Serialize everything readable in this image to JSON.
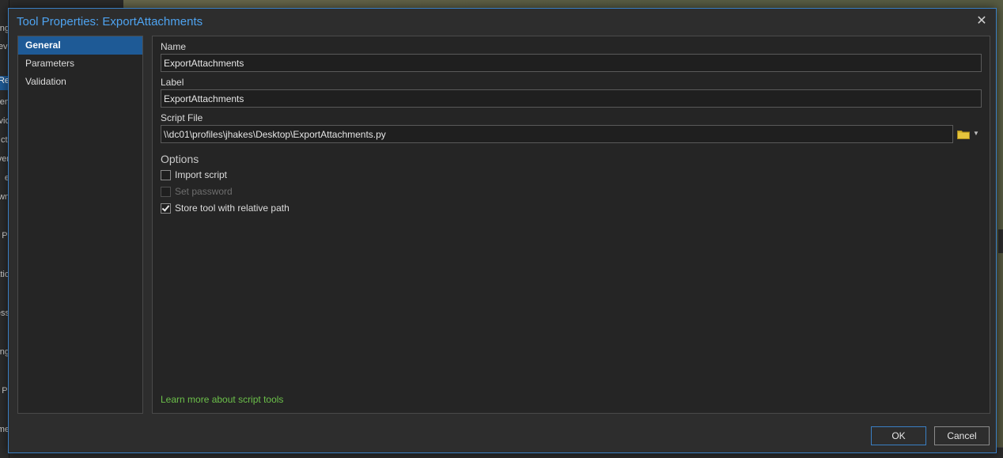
{
  "dialog": {
    "title": "Tool Properties: ExportAttachments",
    "close_glyph": "✕"
  },
  "nav": {
    "items": [
      {
        "label": "General",
        "active": true
      },
      {
        "label": "Parameters",
        "active": false
      },
      {
        "label": "Validation",
        "active": false
      }
    ]
  },
  "general": {
    "name_label": "Name",
    "name_value": "ExportAttachments",
    "label_label": "Label",
    "label_value": "ExportAttachments",
    "script_file_label": "Script File",
    "script_file_value": "\\\\dc01\\profiles\\jhakes\\Desktop\\ExportAttachments.py",
    "options_label": "Options",
    "options": [
      {
        "label": "Import script",
        "checked": false,
        "disabled": false
      },
      {
        "label": "Set password",
        "checked": false,
        "disabled": true
      },
      {
        "label": "Store tool with relative path",
        "checked": true,
        "disabled": false
      }
    ],
    "learn_more": "Learn more about script tools"
  },
  "footer": {
    "ok_label": "OK",
    "cancel_label": "Cancel"
  },
  "icons": {
    "folder": "folder-icon",
    "dropdown": "chevron-down-icon"
  },
  "colors": {
    "accent": "#1e5a96",
    "title_blue": "#4ea3f0",
    "link_green": "#6cc04a",
    "folder_yellow": "#d8b62e"
  },
  "background": {
    "left_fragments": [
      "ng",
      "evi",
      "Re",
      "en",
      "vic",
      "cti",
      "ver",
      "e",
      "wn",
      "Pi",
      "atio",
      "ess",
      "ng",
      "Pi",
      "me"
    ]
  }
}
